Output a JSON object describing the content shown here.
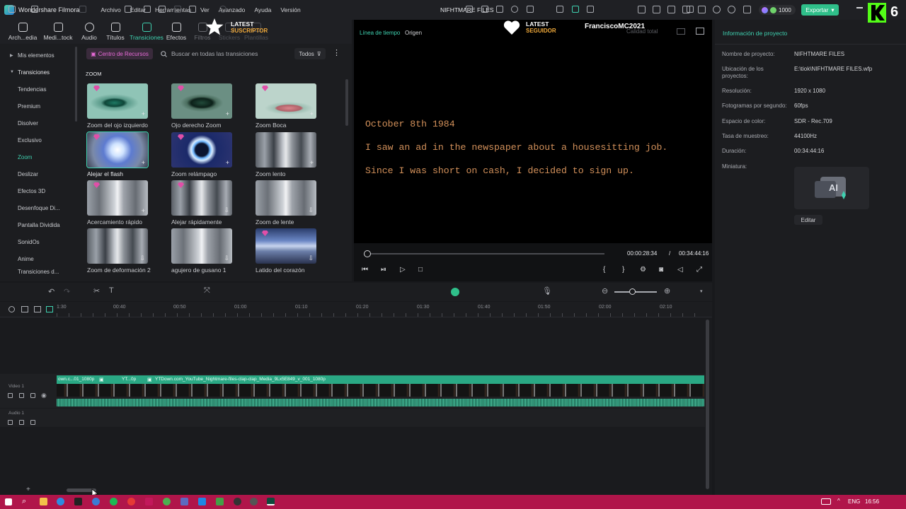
{
  "titlebar": {
    "app_name": "Wondershare Filmora",
    "menus": [
      "Archivo",
      "Editar",
      "Herramientas",
      "Ver",
      "Avanzado",
      "Ayuda",
      "Versión"
    ],
    "document_title": "NIFHTMARE FILES",
    "credits": "1000",
    "export_label": "Exportar"
  },
  "toolbar": {
    "tabs": [
      {
        "label": "Arch...edia",
        "icon": "folder-icon"
      },
      {
        "label": "Medi...tock",
        "icon": "stock-media-icon"
      },
      {
        "label": "Audio",
        "icon": "music-note-icon"
      },
      {
        "label": "Títulos",
        "icon": "text-icon"
      },
      {
        "label": "Transiciones",
        "icon": "transition-icon",
        "active": true
      },
      {
        "label": "Efectos",
        "icon": "effects-icon"
      },
      {
        "label": "Filtros",
        "icon": "filter-icon"
      },
      {
        "label": "Stickers",
        "icon": "sticker-icon"
      },
      {
        "label": "Plantillas",
        "icon": "template-icon"
      }
    ]
  },
  "stream_overlay": {
    "latest_sub_top": "LATEST",
    "latest_sub_bottom": "SUSCRIPTOR",
    "latest_follow_top": "LATEST",
    "latest_follow_bottom": "SEGUIDOR",
    "channel_name": "FranciscoMC2021",
    "corner_badge": "6"
  },
  "sidebar": {
    "my_items": "Mis elementos",
    "section": "Transiciones",
    "items": [
      "Tendencias",
      "Premium",
      "Disolver",
      "Exclusivo",
      "Zoom",
      "Deslizar",
      "Efectos 3D",
      "Desenfoque Di...",
      "Pantalla Dividida",
      "SonidOs",
      "Anime",
      "Transiciones d..."
    ],
    "active_item": "Zoom"
  },
  "browser": {
    "resource_center": "Centro de Recursos",
    "search_placeholder": "Buscar en todas las transiciones",
    "filter_label": "Todos",
    "section_title": "ZOOM",
    "cards": [
      {
        "label": "Zoom del ojo izquierdo",
        "premium": true
      },
      {
        "label": "Ojo derecho Zoom",
        "premium": true
      },
      {
        "label": "Zoom Boca",
        "premium": true
      },
      {
        "label": "Alejar el flash",
        "premium": true,
        "selected": true
      },
      {
        "label": "Zoom relámpago",
        "premium": true
      },
      {
        "label": "Zoom lento",
        "premium": false
      },
      {
        "label": "Acercamiento rápido",
        "premium": true
      },
      {
        "label": "Alejar rápidamente",
        "premium": true
      },
      {
        "label": "Zoom de lente",
        "premium": false
      },
      {
        "label": "Zoom de deformación 2",
        "premium": false
      },
      {
        "label": "agujero de gusano 1",
        "premium": false
      },
      {
        "label": "Latido del corazón",
        "premium": true
      }
    ]
  },
  "preview": {
    "tab_timeline": "Línea de tiempo",
    "tab_source": "Origen",
    "quality": "Calidad total",
    "lines": [
      "October 8th 1984",
      "I saw an ad in the newspaper about a housesitting job.",
      "Since I was short on cash, I decided to sign up."
    ],
    "current_time": "00:00:28:34",
    "separator": "/",
    "total_time": "00:34:44:16",
    "progress_fraction": 0.014
  },
  "project_panel": {
    "header": "Información de proyecto",
    "rows": [
      {
        "label": "Nombre de proyecto:",
        "value": "NIFHTMARE FILES"
      },
      {
        "label": "Ubicación de los proyectos:",
        "value": "E:\\tiok\\NIFHTMARE FILES.wfp"
      },
      {
        "label": "Resolución:",
        "value": "1920 x 1080"
      },
      {
        "label": "Fotogramas por segundo:",
        "value": "60fps"
      },
      {
        "label": "Espacio de color:",
        "value": "SDR - Rec.709"
      },
      {
        "label": "Tasa de muestreo:",
        "value": "44100Hz"
      },
      {
        "label": "Duración:",
        "value": "00:34:44:16"
      },
      {
        "label": "Miniatura:",
        "value": ""
      }
    ],
    "edit_label": "Editar"
  },
  "timeline": {
    "ruler": [
      "1:30",
      "00:40",
      "00:50",
      "01:00",
      "01:10",
      "01:20",
      "01:30",
      "01:40",
      "01:50",
      "02:00",
      "02:10"
    ],
    "video_track": "Video 1",
    "audio_track": "Audio 1",
    "clip_labels": [
      "own.c...01_1080p",
      "YT...0p",
      "YTDown.com_YouTube_Nightmare-files-clap-clap_Media_9Lx5E849_v_001_1080p"
    ]
  },
  "taskbar": {
    "lang": "ENG",
    "time": "16:56"
  }
}
